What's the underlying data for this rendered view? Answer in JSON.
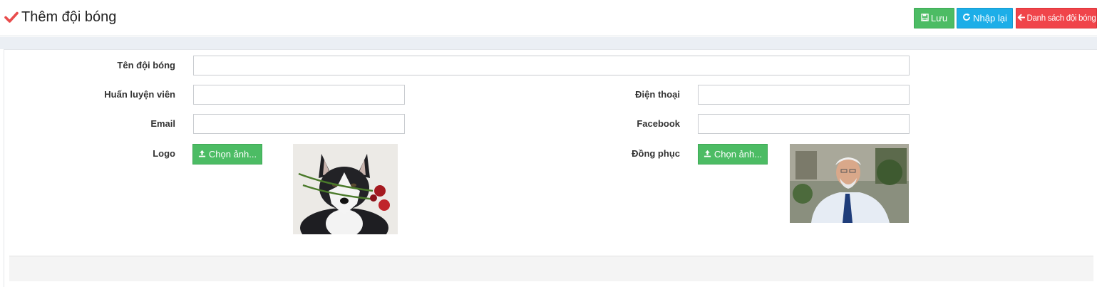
{
  "header": {
    "title": "Thêm đội bóng",
    "buttons": {
      "save": "Lưu",
      "reset": "Nhập lại",
      "list": "Danh sách đội bóng"
    }
  },
  "form": {
    "team_name": {
      "label": "Tên đội bóng",
      "value": ""
    },
    "coach": {
      "label": "Huấn luyện viên",
      "value": ""
    },
    "phone": {
      "label": "Điện thoại",
      "value": ""
    },
    "email": {
      "label": "Email",
      "value": ""
    },
    "facebook": {
      "label": "Facebook",
      "value": ""
    },
    "logo": {
      "label": "Logo",
      "button": "Chọn ảnh..."
    },
    "uniform": {
      "label": "Đồng phục",
      "button": "Chọn ảnh..."
    }
  },
  "colors": {
    "success": "#4cbc64",
    "info": "#1caee8",
    "danger": "#f0444a",
    "check": "#e84c4c"
  },
  "icons": {
    "title": "check-icon",
    "save": "floppy-disk-icon",
    "reset": "refresh-icon",
    "list": "arrow-left-icon",
    "upload": "upload-icon"
  }
}
